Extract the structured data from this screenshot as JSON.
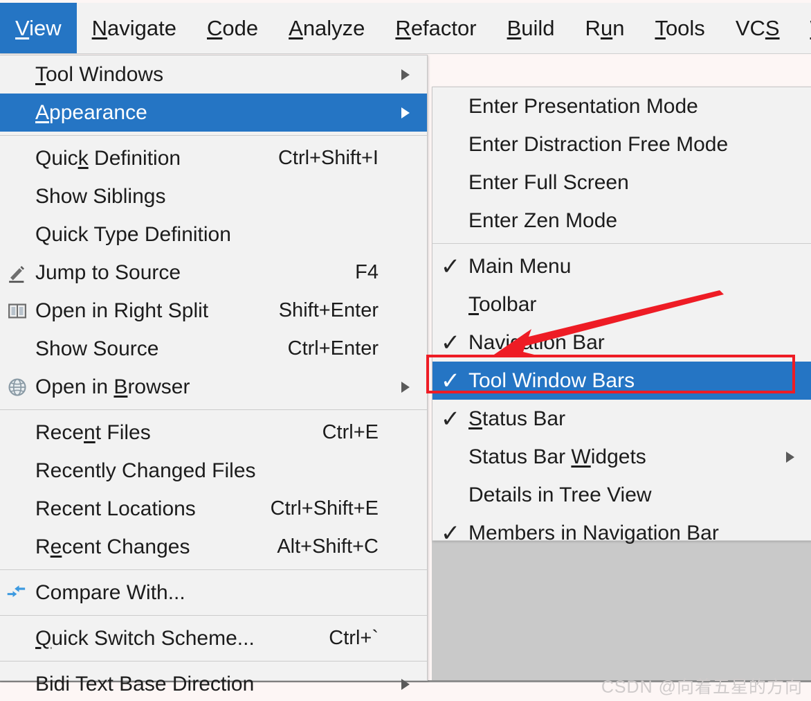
{
  "menubar": {
    "items": [
      {
        "label": "View",
        "mnemonic": "V",
        "selected": true
      },
      {
        "label": "Navigate",
        "mnemonic": "N",
        "selected": false
      },
      {
        "label": "Code",
        "mnemonic": "C",
        "selected": false
      },
      {
        "label": "Analyze",
        "mnemonic": "A",
        "selected": false
      },
      {
        "label": "Refactor",
        "mnemonic": "R",
        "selected": false
      },
      {
        "label": "Build",
        "mnemonic": "B",
        "selected": false
      },
      {
        "label": "Run",
        "mnemonic": "u",
        "selected": false
      },
      {
        "label": "Tools",
        "mnemonic": "T",
        "selected": false
      },
      {
        "label": "VCS",
        "mnemonic": "S",
        "selected": false
      },
      {
        "label": "Win",
        "mnemonic": "W",
        "selected": false
      }
    ]
  },
  "view_menu": {
    "rows": [
      {
        "label": "Tool Windows",
        "accel": "",
        "icon": "",
        "arrow": true,
        "check": false,
        "selected": false
      },
      {
        "label": "Appearance",
        "accel": "",
        "icon": "",
        "arrow": true,
        "check": false,
        "selected": true
      },
      {
        "separator": true
      },
      {
        "label": "Quick Definition",
        "accel": "Ctrl+Shift+I",
        "icon": "",
        "arrow": false,
        "check": false,
        "selected": false
      },
      {
        "label": "Show Siblings",
        "accel": "",
        "icon": "",
        "arrow": false,
        "check": false,
        "selected": false
      },
      {
        "label": "Quick Type Definition",
        "accel": "",
        "icon": "",
        "arrow": false,
        "check": false,
        "selected": false
      },
      {
        "label": "Jump to Source",
        "accel": "F4",
        "icon": "pencil-icon",
        "arrow": false,
        "check": false,
        "selected": false
      },
      {
        "label": "Open in Right Split",
        "accel": "Shift+Enter",
        "icon": "split-pane-icon",
        "arrow": false,
        "check": false,
        "selected": false
      },
      {
        "label": "Show Source",
        "accel": "Ctrl+Enter",
        "icon": "",
        "arrow": false,
        "check": false,
        "selected": false
      },
      {
        "label": "Open in Browser",
        "accel": "",
        "icon": "globe-icon",
        "arrow": true,
        "check": false,
        "selected": false
      },
      {
        "separator": true
      },
      {
        "label": "Recent Files",
        "accel": "Ctrl+E",
        "icon": "",
        "arrow": false,
        "check": false,
        "selected": false
      },
      {
        "label": "Recently Changed Files",
        "accel": "",
        "icon": "",
        "arrow": false,
        "check": false,
        "selected": false
      },
      {
        "label": "Recent Locations",
        "accel": "Ctrl+Shift+E",
        "icon": "",
        "arrow": false,
        "check": false,
        "selected": false
      },
      {
        "label": "Recent Changes",
        "accel": "Alt+Shift+C",
        "icon": "",
        "arrow": false,
        "check": false,
        "selected": false
      },
      {
        "separator": true
      },
      {
        "label": "Compare With...",
        "accel": "",
        "icon": "compare-icon",
        "arrow": false,
        "check": false,
        "selected": false
      },
      {
        "separator": true
      },
      {
        "label": "Quick Switch Scheme...",
        "accel": "Ctrl+`",
        "icon": "",
        "arrow": false,
        "check": false,
        "selected": false
      },
      {
        "separator": true
      },
      {
        "label": "Bidi Text Base Direction",
        "accel": "",
        "icon": "",
        "arrow": true,
        "check": false,
        "selected": false
      }
    ]
  },
  "appearance_menu": {
    "rows": [
      {
        "label": "Enter Presentation Mode",
        "accel": "",
        "arrow": false,
        "check": false,
        "selected": false
      },
      {
        "label": "Enter Distraction Free Mode",
        "accel": "",
        "arrow": false,
        "check": false,
        "selected": false
      },
      {
        "label": "Enter Full Screen",
        "accel": "",
        "arrow": false,
        "check": false,
        "selected": false
      },
      {
        "label": "Enter Zen Mode",
        "accel": "",
        "arrow": false,
        "check": false,
        "selected": false
      },
      {
        "separator": true
      },
      {
        "label": "Main Menu",
        "accel": "",
        "arrow": false,
        "check": true,
        "selected": false
      },
      {
        "label": "Toolbar",
        "accel": "",
        "arrow": false,
        "check": false,
        "selected": false
      },
      {
        "label": "Navigation Bar",
        "accel": "",
        "arrow": false,
        "check": true,
        "selected": false
      },
      {
        "label": "Tool Window Bars",
        "accel": "",
        "arrow": false,
        "check": true,
        "selected": true
      },
      {
        "label": "Status Bar",
        "accel": "",
        "arrow": false,
        "check": true,
        "selected": false
      },
      {
        "label": "Status Bar Widgets",
        "accel": "",
        "arrow": true,
        "check": false,
        "selected": false
      },
      {
        "label": "Details in Tree View",
        "accel": "",
        "arrow": false,
        "check": false,
        "selected": false
      },
      {
        "label": "Members in Navigation Bar",
        "accel": "",
        "arrow": false,
        "check": true,
        "selected": false
      }
    ]
  },
  "annotation": {
    "box_target": "Tool Window Bars",
    "color": "#ee1c25"
  },
  "watermark": {
    "text": "CSDN @向着五星的方向"
  },
  "colors": {
    "selection": "#2575c4",
    "menu_bg": "#f2f2f2",
    "annotation_red": "#ee1c25",
    "backdrop_gray": "#c9c9c9"
  }
}
